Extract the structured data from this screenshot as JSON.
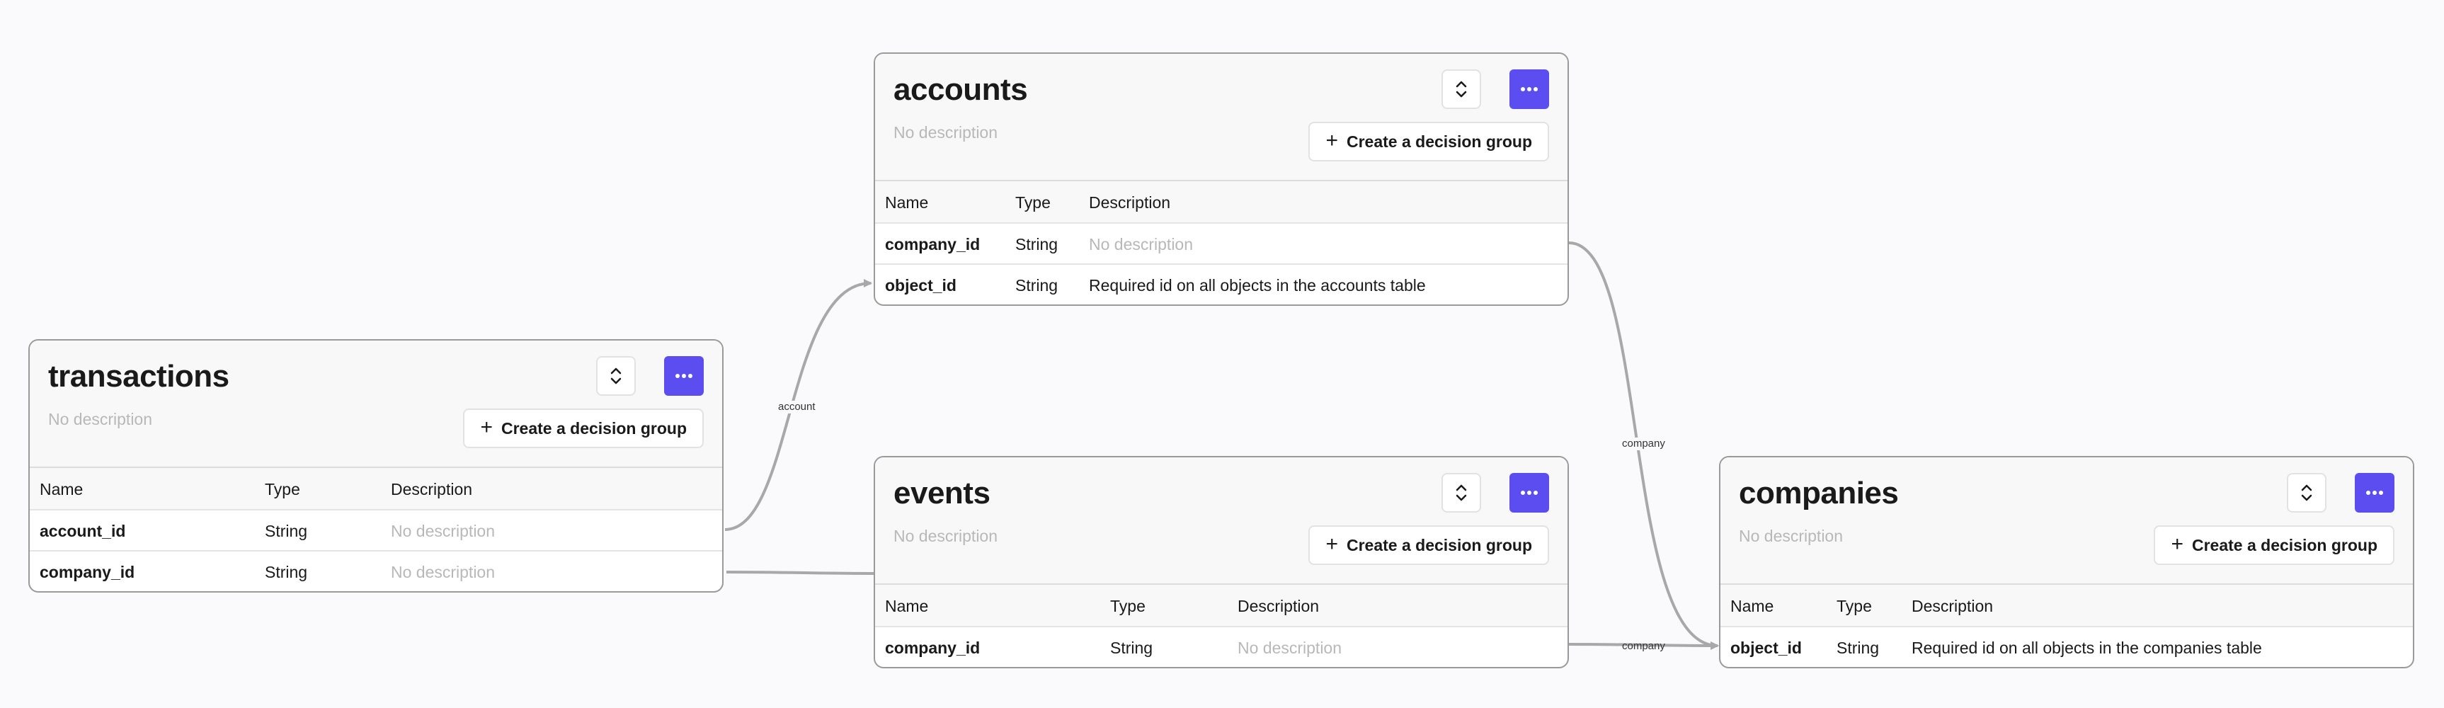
{
  "columns": {
    "name": "Name",
    "type": "Type",
    "description": "Description"
  },
  "create_label": "Create a decision group",
  "accent_color": "#5b4df0",
  "tables": {
    "transactions": {
      "title": "transactions",
      "description": "No description",
      "rows": [
        {
          "name": "account_id",
          "type": "String",
          "description": "No description"
        },
        {
          "name": "company_id",
          "type": "String",
          "description": "No description"
        }
      ]
    },
    "accounts": {
      "title": "accounts",
      "description": "No description",
      "rows": [
        {
          "name": "company_id",
          "type": "String",
          "description": "No description"
        },
        {
          "name": "object_id",
          "type": "String",
          "description": "Required id on all objects in the accounts table"
        }
      ]
    },
    "events": {
      "title": "events",
      "description": "No description",
      "rows": [
        {
          "name": "company_id",
          "type": "String",
          "description": "No description"
        }
      ]
    },
    "companies": {
      "title": "companies",
      "description": "No description",
      "rows": [
        {
          "name": "object_id",
          "type": "String",
          "description": "Required id on all objects in the companies table"
        }
      ]
    }
  },
  "links": [
    {
      "label": "account",
      "from": "transactions.account_id",
      "to": "accounts.object_id"
    },
    {
      "label": "company",
      "from": "accounts.company_id",
      "to": "companies.object_id"
    },
    {
      "label": "company",
      "from": "events.company_id",
      "to": "companies.object_id"
    },
    {
      "label": "",
      "from": "transactions.company_id",
      "to": "events"
    }
  ]
}
